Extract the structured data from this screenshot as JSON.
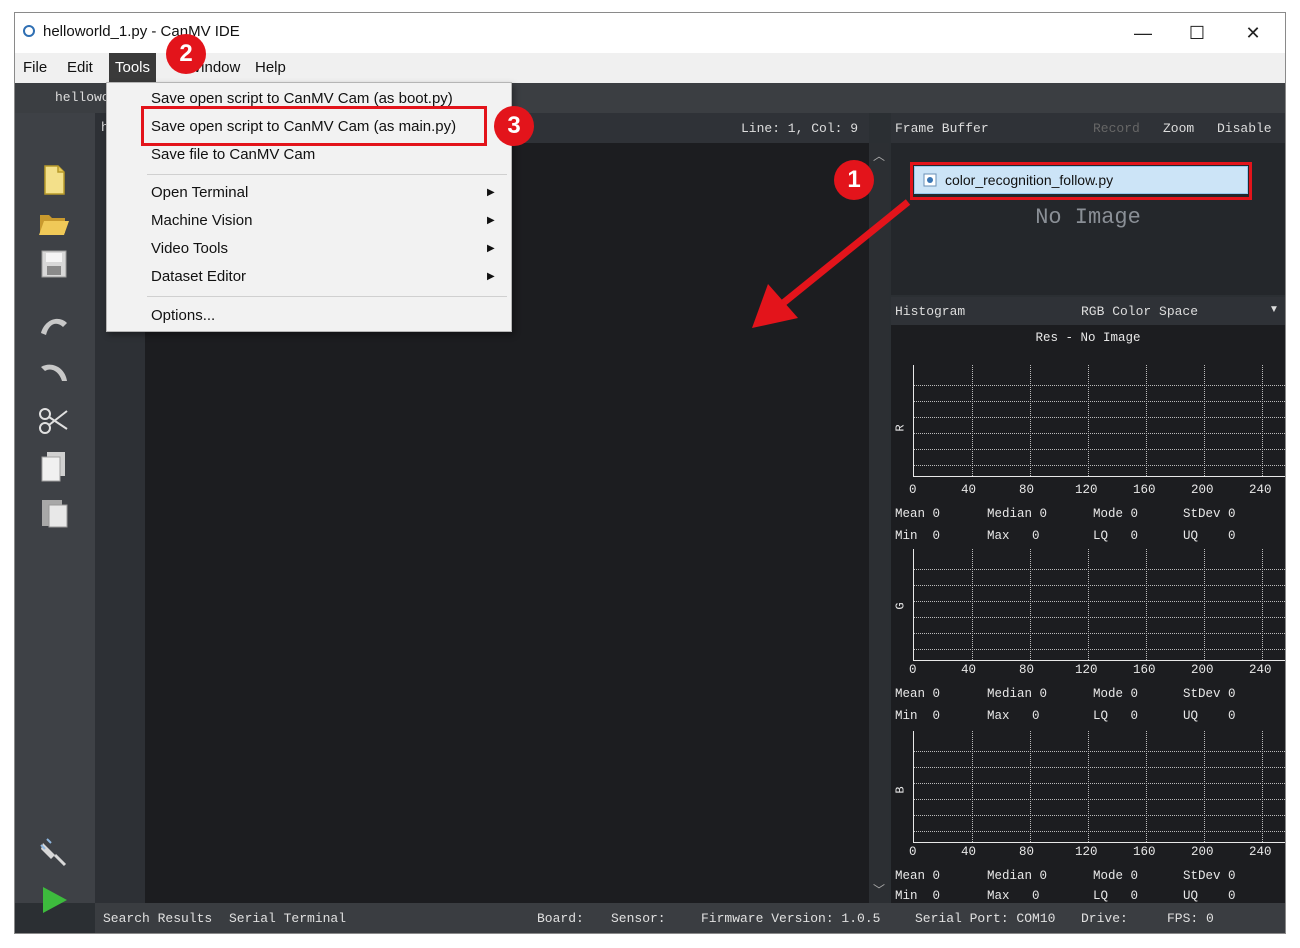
{
  "window": {
    "title": "helloworld_1.py - CanMV IDE",
    "controls": {
      "minimize": "—",
      "maximize": "☐",
      "close": "✕"
    }
  },
  "menubar": [
    "File",
    "Edit",
    "Tools",
    "Window",
    "Help"
  ],
  "tab": {
    "label": "hellowo"
  },
  "editor": {
    "doc_label": "h",
    "cursor": "Line: 1, Col: 9"
  },
  "tools_menu": {
    "items": [
      "Save open script to CanMV Cam (as boot.py)",
      "Save open script to CanMV Cam (as main.py)",
      "Save file to CanMV Cam",
      "Open Terminal",
      "Machine Vision",
      "Video Tools",
      "Dataset Editor",
      "Options..."
    ],
    "submenu_arrow": "▶"
  },
  "frame_buffer": {
    "title": "Frame Buffer",
    "record": "Record",
    "zoom": "Zoom",
    "disable": "Disable",
    "placeholder": "No Image",
    "dragged_file": "color_recognition_follow.py"
  },
  "histogram": {
    "title": "Histogram",
    "color_space": "RGB Color Space",
    "res_label": "Res - No Image",
    "channels": [
      "R",
      "G",
      "B"
    ],
    "x_ticks": [
      "0",
      "40",
      "80",
      "120",
      "160",
      "200",
      "240"
    ],
    "stats_row1": [
      "Mean 0",
      "Median 0",
      "Mode 0",
      "StDev 0"
    ],
    "stats_row2": [
      "Min  0",
      "Max   0",
      "LQ   0",
      "UQ    0"
    ]
  },
  "statusbar": {
    "search_results": "Search Results",
    "serial_terminal": "Serial Terminal",
    "board": "Board:",
    "sensor": "Sensor:",
    "firmware": "Firmware Version: 1.0.5",
    "serial_port": "Serial Port: COM10",
    "drive": "Drive:",
    "fps": "FPS: 0"
  },
  "annotations": {
    "step1": "1",
    "step2": "2",
    "step3": "3"
  },
  "colors": {
    "annotation_red": "#e3141b",
    "editor_bg": "#1c1d20",
    "menu_bg": "#f2f2f2"
  },
  "icons": [
    "new-file-icon",
    "open-folder-icon",
    "save-icon",
    "undo-icon",
    "redo-icon",
    "cut-icon",
    "copy-icon",
    "paste-icon",
    "connect-icon",
    "run-icon"
  ]
}
